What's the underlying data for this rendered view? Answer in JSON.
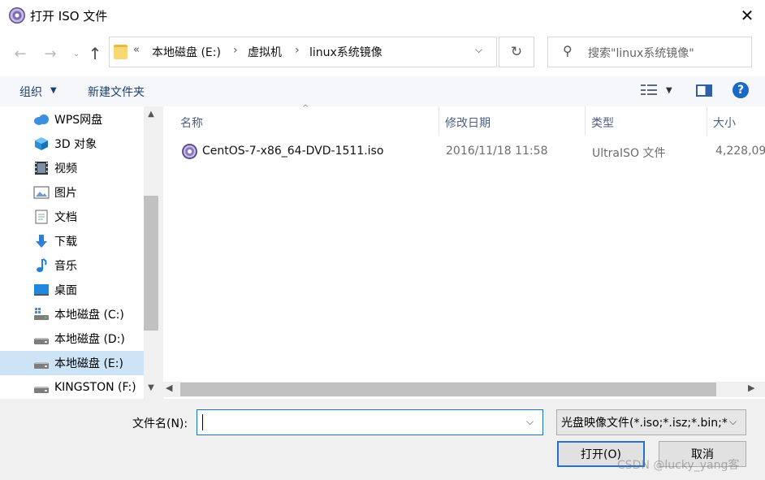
{
  "window": {
    "title": "打开 ISO 文件",
    "close_glyph": "✕"
  },
  "address": {
    "chevrons": "«",
    "crumbs": [
      "本地磁盘 (E:)",
      "虚拟机",
      "linux系统镜像"
    ],
    "separator": "›",
    "search_placeholder": "搜索\"linux系统镜像\""
  },
  "toolbar": {
    "organize_label": "组织",
    "new_folder_label": "新建文件夹",
    "help_glyph": "?"
  },
  "nav": {
    "items": [
      {
        "label": "WPS网盘",
        "icon": "cloud-icon"
      },
      {
        "label": "3D 对象",
        "icon": "cube-icon"
      },
      {
        "label": "视频",
        "icon": "film-icon"
      },
      {
        "label": "图片",
        "icon": "picture-icon"
      },
      {
        "label": "文档",
        "icon": "document-icon"
      },
      {
        "label": "下载",
        "icon": "download-arrow-icon"
      },
      {
        "label": "音乐",
        "icon": "music-note-icon"
      },
      {
        "label": "桌面",
        "icon": "desktop-icon"
      },
      {
        "label": "本地磁盘 (C:)",
        "icon": "drive-icon"
      },
      {
        "label": "本地磁盘 (D:)",
        "icon": "drive-icon"
      },
      {
        "label": "本地磁盘 (E:)",
        "icon": "drive-icon",
        "selected": true
      },
      {
        "label": "KINGSTON (F:)",
        "icon": "usb-drive-icon"
      }
    ]
  },
  "files": {
    "columns": [
      "名称",
      "修改日期",
      "类型",
      "大小"
    ],
    "rows": [
      {
        "name": "CentOS-7-x86_64-DVD-1511.iso",
        "date": "2016/11/18 11:58",
        "type": "UltraISO 文件",
        "size": "4,228,09"
      }
    ]
  },
  "bottom": {
    "filename_label": "文件名(N):",
    "filename_value": "",
    "filter_value": "光盘映像文件(*.iso;*.isz;*.bin;*",
    "open_label": "打开(O)",
    "cancel_label": "取消"
  },
  "watermark": "CSDN @lucky_yang客",
  "colors": {
    "accent": "#1a73d0",
    "selection": "#cde4f7",
    "header_text": "#4d6082"
  }
}
